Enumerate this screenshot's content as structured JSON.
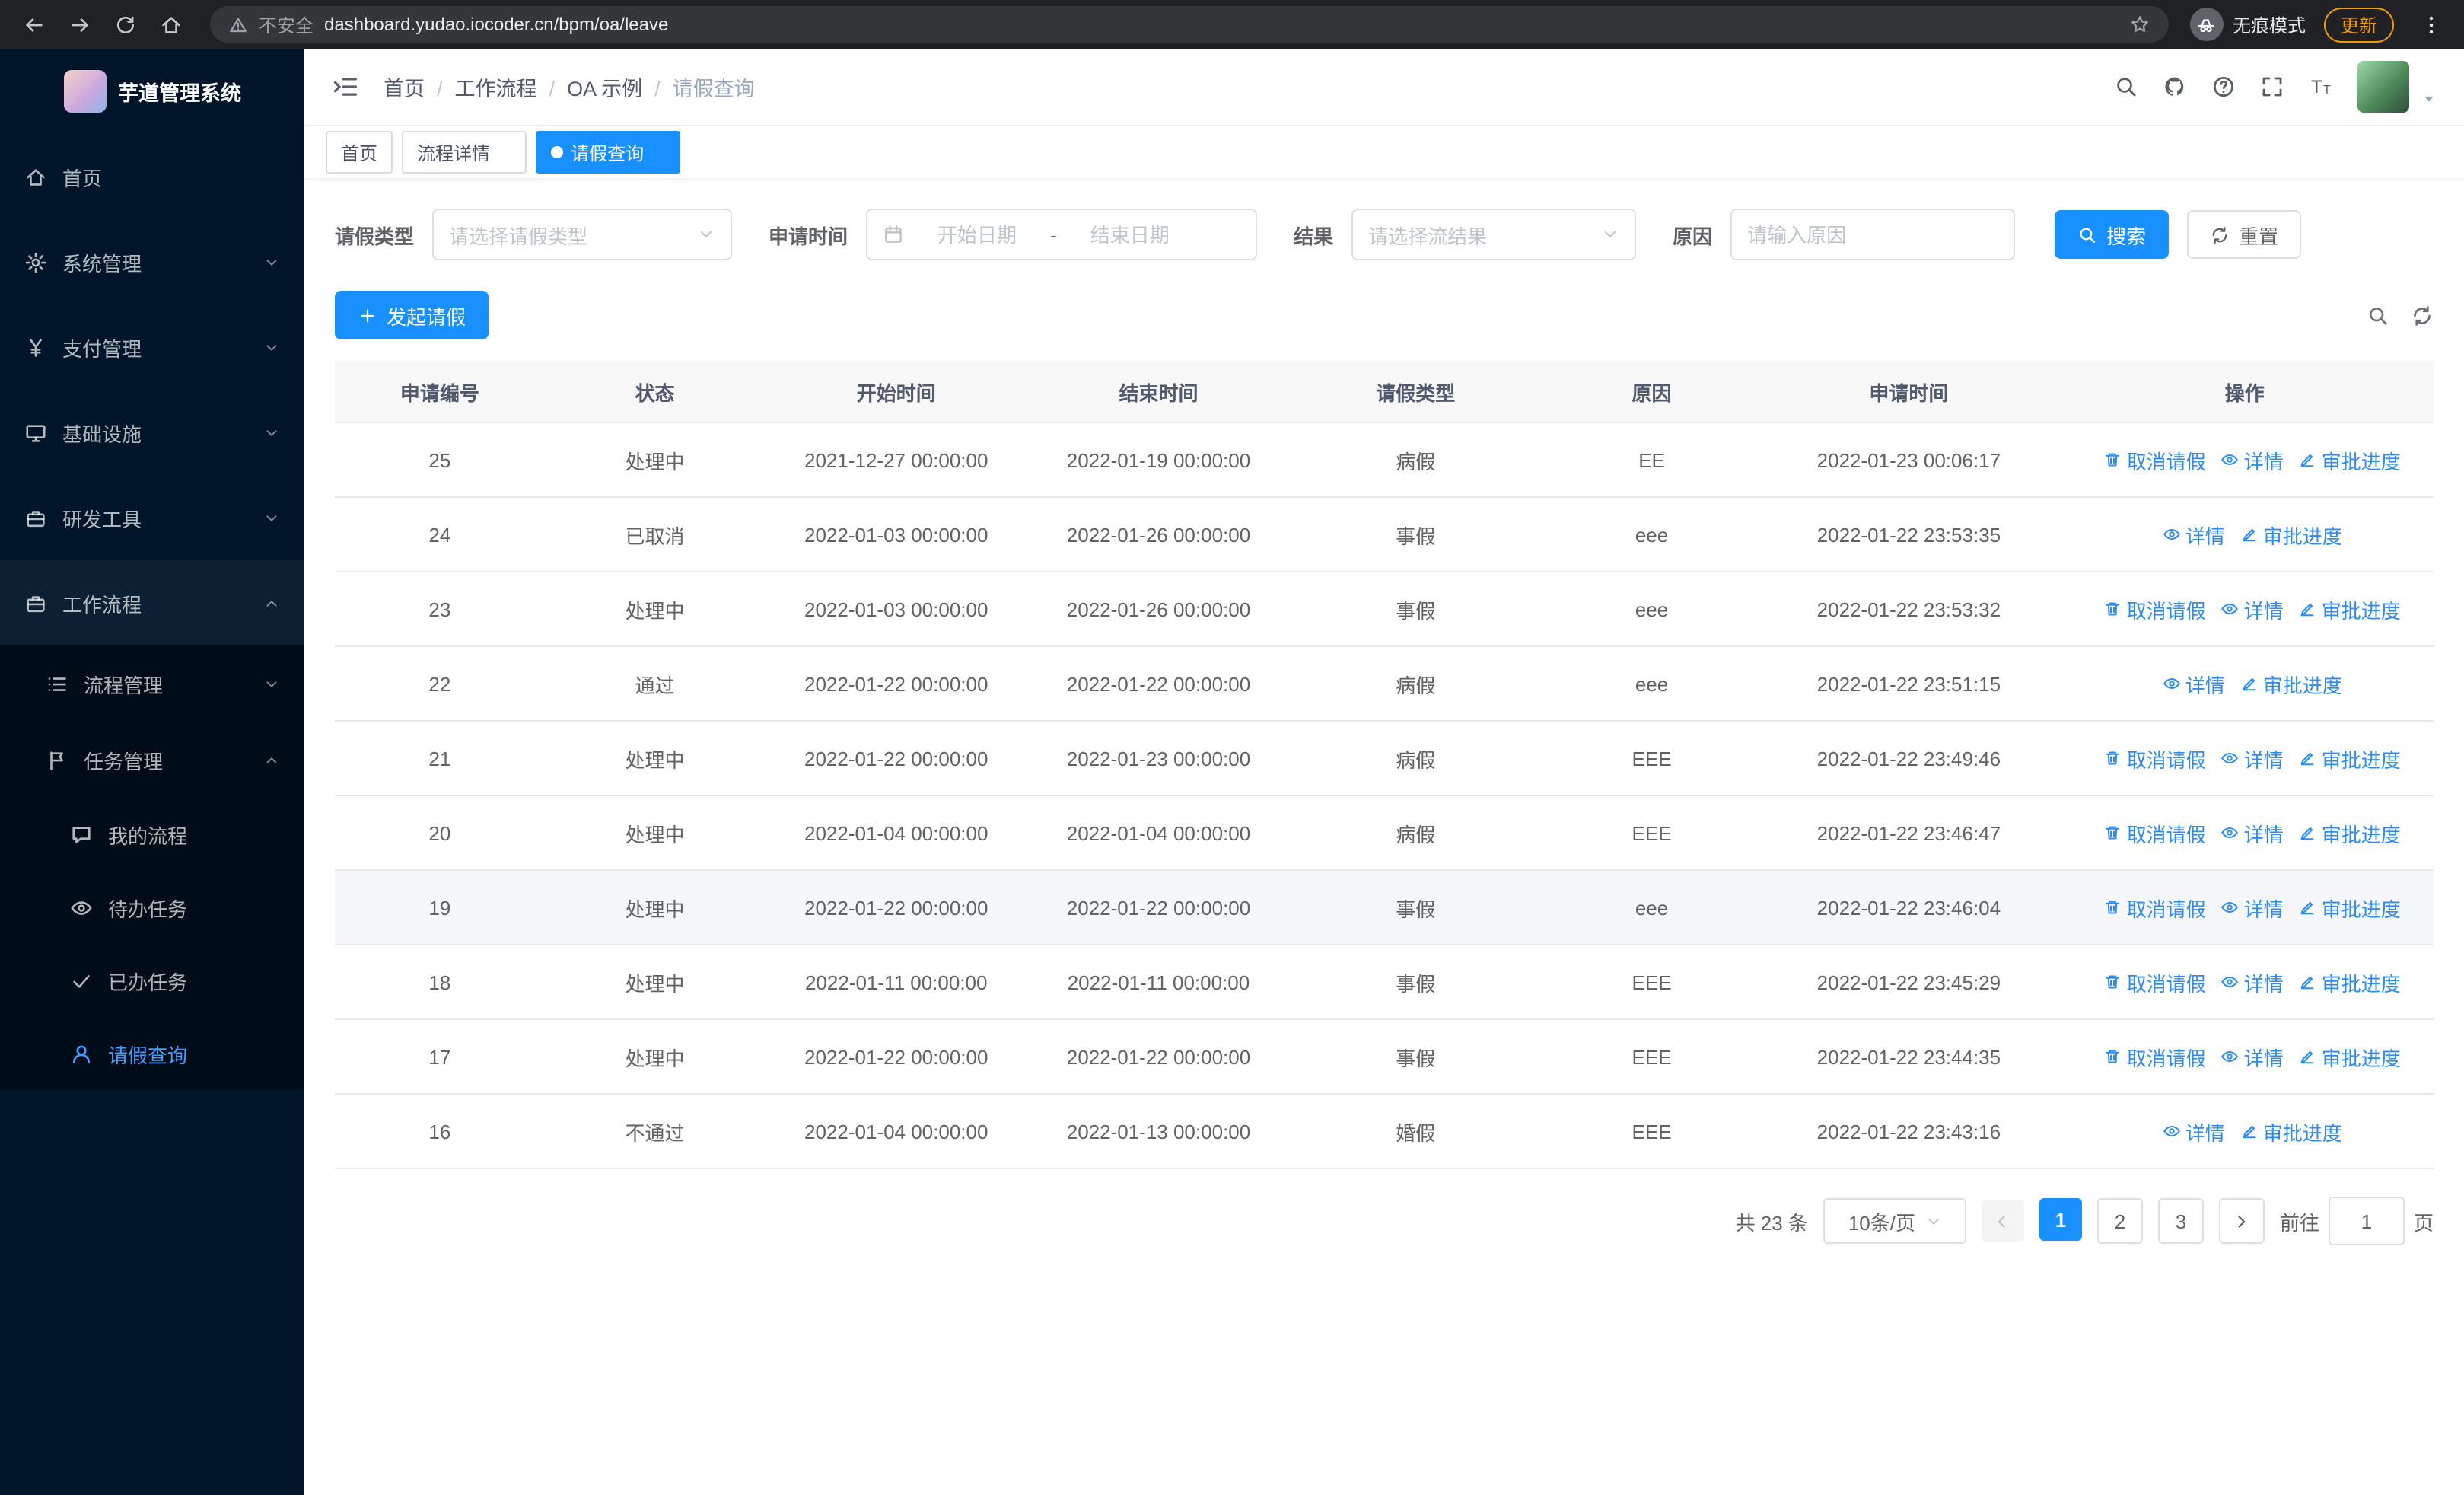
{
  "browser": {
    "security_warning": "不安全",
    "url": "dashboard.yudao.iocoder.cn/bpm/oa/leave",
    "incognito_label": "无痕模式",
    "update_label": "更新"
  },
  "sidebar": {
    "logo_title": "芋道管理系统",
    "items": [
      {
        "label": "首页",
        "level": 1,
        "icon": "home"
      },
      {
        "label": "系统管理",
        "level": 1,
        "icon": "gear",
        "expand": "down"
      },
      {
        "label": "支付管理",
        "level": 1,
        "icon": "yen",
        "expand": "down"
      },
      {
        "label": "基础设施",
        "level": 1,
        "icon": "monitor",
        "expand": "down"
      },
      {
        "label": "研发工具",
        "level": 1,
        "icon": "briefcase",
        "expand": "down"
      },
      {
        "label": "工作流程",
        "level": 1,
        "icon": "briefcase",
        "expand": "up",
        "highlight": true
      },
      {
        "label": "流程管理",
        "level": 2,
        "icon": "list",
        "expand": "down"
      },
      {
        "label": "任务管理",
        "level": 2,
        "icon": "flag",
        "expand": "up"
      },
      {
        "label": "我的流程",
        "level": 3,
        "icon": "chat"
      },
      {
        "label": "待办任务",
        "level": 3,
        "icon": "eye"
      },
      {
        "label": "已办任务",
        "level": 3,
        "icon": "check"
      },
      {
        "label": "请假查询",
        "level": 3,
        "icon": "user",
        "active": true
      }
    ]
  },
  "header": {
    "breadcrumb": [
      "首页",
      "工作流程",
      "OA 示例",
      "请假查询"
    ]
  },
  "tabs": [
    {
      "label": "首页"
    },
    {
      "label": "流程详情",
      "closable": true
    },
    {
      "label": "请假查询",
      "closable": true,
      "active": true
    }
  ],
  "filters": {
    "type_label": "请假类型",
    "type_placeholder": "请选择请假类型",
    "time_label": "申请时间",
    "start_placeholder": "开始日期",
    "separator": "-",
    "end_placeholder": "结束日期",
    "result_label": "结果",
    "result_placeholder": "请选择流结果",
    "reason_label": "原因",
    "reason_placeholder": "请输入原因",
    "search_label": "搜索",
    "reset_label": "重置"
  },
  "toolbar": {
    "create_label": "发起请假"
  },
  "table": {
    "columns": [
      "申请编号",
      "状态",
      "开始时间",
      "结束时间",
      "请假类型",
      "原因",
      "申请时间",
      "操作"
    ],
    "action_labels": {
      "cancel": "取消请假",
      "detail": "详情",
      "progress": "审批进度"
    },
    "rows": [
      {
        "id": "25",
        "status": "处理中",
        "start": "2021-12-27 00:00:00",
        "end": "2022-01-19 00:00:00",
        "type": "病假",
        "reason": "EE",
        "apply_time": "2022-01-23 00:06:17",
        "can_cancel": true
      },
      {
        "id": "24",
        "status": "已取消",
        "start": "2022-01-03 00:00:00",
        "end": "2022-01-26 00:00:00",
        "type": "事假",
        "reason": "eee",
        "apply_time": "2022-01-22 23:53:35",
        "can_cancel": false
      },
      {
        "id": "23",
        "status": "处理中",
        "start": "2022-01-03 00:00:00",
        "end": "2022-01-26 00:00:00",
        "type": "事假",
        "reason": "eee",
        "apply_time": "2022-01-22 23:53:32",
        "can_cancel": true
      },
      {
        "id": "22",
        "status": "通过",
        "start": "2022-01-22 00:00:00",
        "end": "2022-01-22 00:00:00",
        "type": "病假",
        "reason": "eee",
        "apply_time": "2022-01-22 23:51:15",
        "can_cancel": false
      },
      {
        "id": "21",
        "status": "处理中",
        "start": "2022-01-22 00:00:00",
        "end": "2022-01-23 00:00:00",
        "type": "病假",
        "reason": "EEE",
        "apply_time": "2022-01-22 23:49:46",
        "can_cancel": true
      },
      {
        "id": "20",
        "status": "处理中",
        "start": "2022-01-04 00:00:00",
        "end": "2022-01-04 00:00:00",
        "type": "病假",
        "reason": "EEE",
        "apply_time": "2022-01-22 23:46:47",
        "can_cancel": true
      },
      {
        "id": "19",
        "status": "处理中",
        "start": "2022-01-22 00:00:00",
        "end": "2022-01-22 00:00:00",
        "type": "事假",
        "reason": "eee",
        "apply_time": "2022-01-22 23:46:04",
        "can_cancel": true,
        "highlighted": true
      },
      {
        "id": "18",
        "status": "处理中",
        "start": "2022-01-11 00:00:00",
        "end": "2022-01-11 00:00:00",
        "type": "事假",
        "reason": "EEE",
        "apply_time": "2022-01-22 23:45:29",
        "can_cancel": true
      },
      {
        "id": "17",
        "status": "处理中",
        "start": "2022-01-22 00:00:00",
        "end": "2022-01-22 00:00:00",
        "type": "事假",
        "reason": "EEE",
        "apply_time": "2022-01-22 23:44:35",
        "can_cancel": true
      },
      {
        "id": "16",
        "status": "不通过",
        "start": "2022-01-04 00:00:00",
        "end": "2022-01-13 00:00:00",
        "type": "婚假",
        "reason": "EEE",
        "apply_time": "2022-01-22 23:43:16",
        "can_cancel": false
      }
    ]
  },
  "pagination": {
    "total_text": "共 23 条",
    "page_size": "10条/页",
    "pages": [
      "1",
      "2",
      "3"
    ],
    "current": "1",
    "goto_label": "前往",
    "goto_value": "1",
    "page_suffix": "页"
  }
}
